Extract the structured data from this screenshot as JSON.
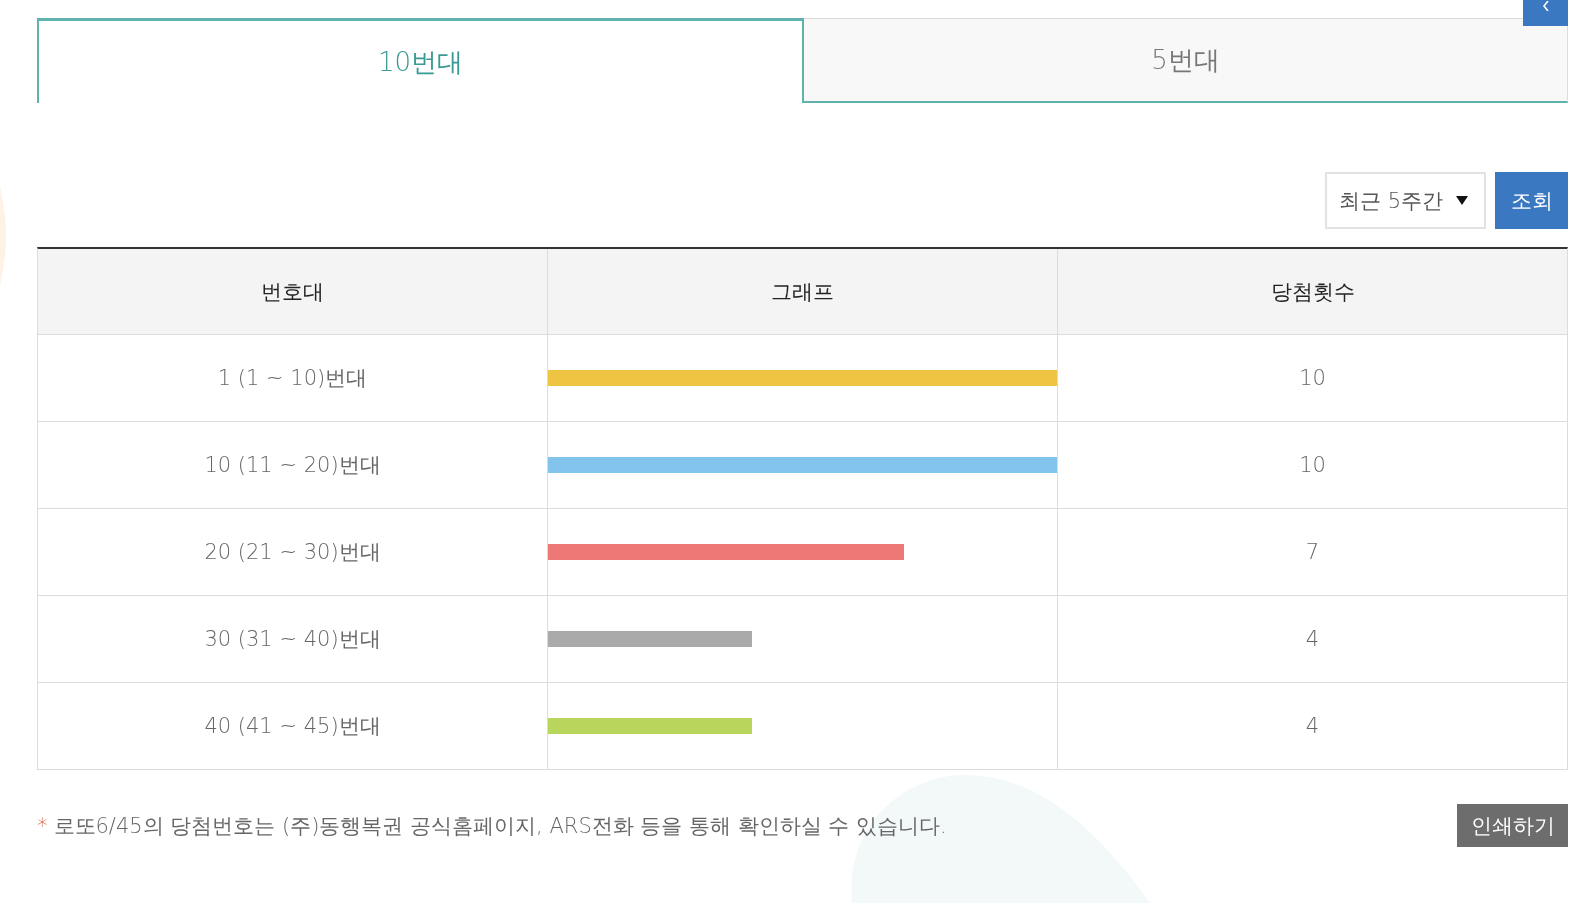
{
  "tabs": [
    {
      "label": "10번대",
      "selected": true
    },
    {
      "label": "5번대",
      "selected": false
    }
  ],
  "filter": {
    "period": "최근 5주간",
    "button": "조회"
  },
  "table": {
    "columns": [
      "번호대",
      "그래프",
      "당첨횟수"
    ],
    "rows": [
      {
        "range": "1 (1 ~ 10)번대",
        "level": 1,
        "color": "#f0c443",
        "count": "10"
      },
      {
        "range": "10 (11 ~ 20)번대",
        "level": 1,
        "color": "#82c4ec",
        "count": "10"
      },
      {
        "range": "20 (21 ~ 30)번대",
        "level": 0.7,
        "color": "#ee7876",
        "count": "7"
      },
      {
        "range": "30 (31 ~ 40)번대",
        "level": 0.4,
        "color": "#aaaaaa",
        "count": "4"
      },
      {
        "range": "40 (41 ~ 45)번대",
        "level": 0.4,
        "color": "#b9d65c",
        "count": "4"
      }
    ]
  },
  "note": {
    "mark": "*",
    "text": "로또6/45의 당첨번호는 (주)동행복권 공식홈페이지, ARS전화 등을 통해 확인하실 수 있습니다."
  },
  "print_button": "인쇄하기"
}
